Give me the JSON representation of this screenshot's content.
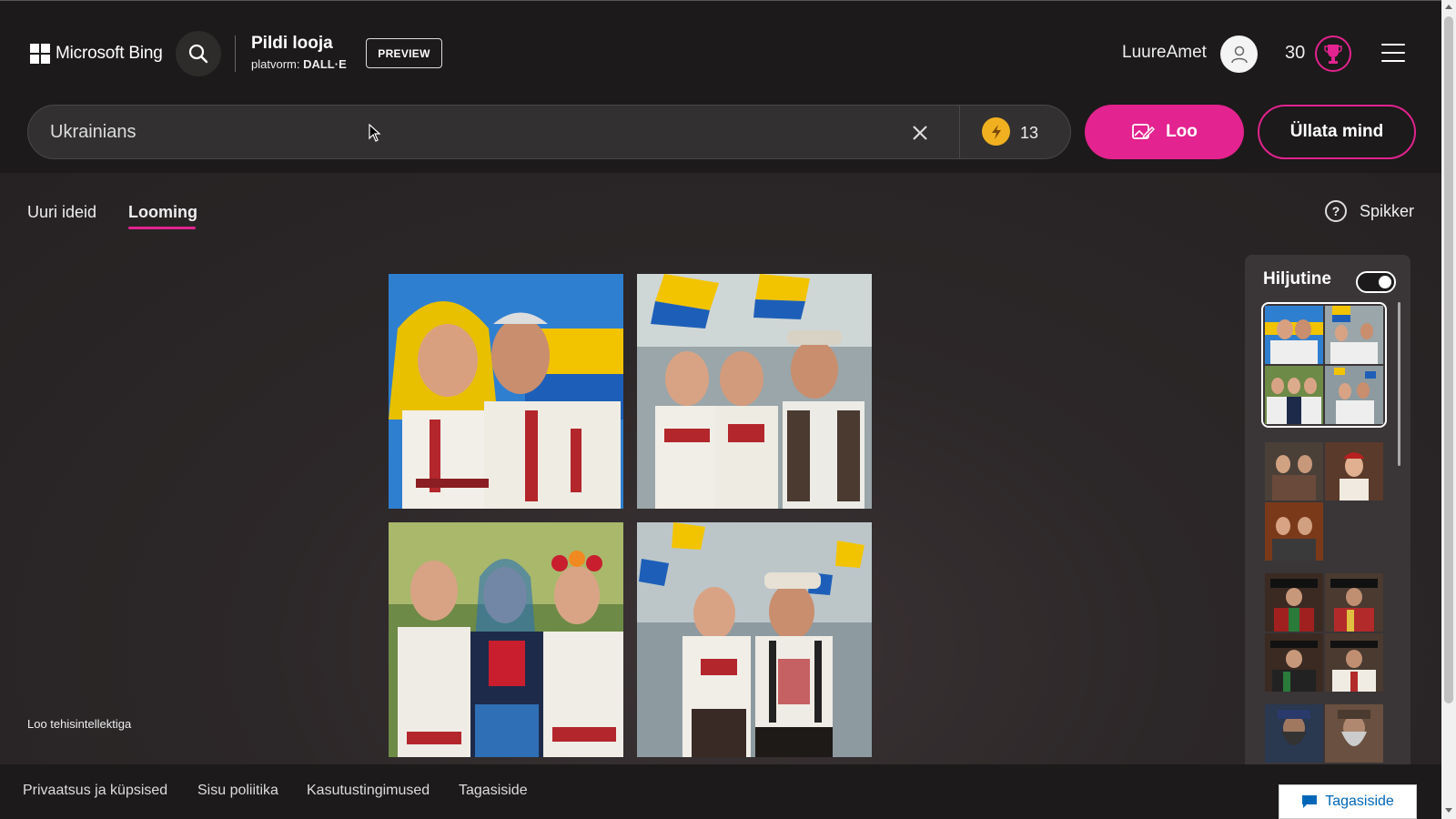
{
  "header": {
    "brand": "Microsoft Bing",
    "app_title": "Pildi looja",
    "platform_label": "platvorm:",
    "platform_name": "DALL·E",
    "preview_label": "PREVIEW",
    "username": "LuureAmet",
    "points": "30",
    "icons": [
      "windows-logo-icon",
      "search-icon",
      "user-avatar-icon",
      "trophy-icon",
      "hamburger-menu-icon"
    ]
  },
  "search": {
    "value": "Ukrainians",
    "boost_count": "13",
    "create_label": "Loo",
    "surprise_label": "Üllata mind"
  },
  "tabs": [
    {
      "label": "Uuri ideid",
      "active": false
    },
    {
      "label": "Looming",
      "active": true
    }
  ],
  "help_label": "Spikker",
  "recent": {
    "title": "Hiljutine",
    "toggle_on": true
  },
  "caption": "Loo tehisintellektiga",
  "footer": {
    "links": [
      "Privaatsus ja küpsised",
      "Sisu poliitika",
      "Kasutustingimused",
      "Tagasiside"
    ],
    "feedback_label": "Tagasiside"
  },
  "colors": {
    "accent": "#e3238f",
    "boost": "#f0b020",
    "background": "#1c1a1a"
  }
}
